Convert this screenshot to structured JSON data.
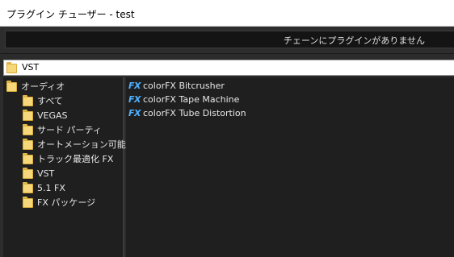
{
  "window": {
    "title": "プラグイン チューザー - test"
  },
  "chain": {
    "empty_text": "チェーンにプラグインがありません"
  },
  "path": {
    "text": "VST",
    "icon": "folder-icon"
  },
  "tree": {
    "root": {
      "label": "オーディオ",
      "icon": "folder-icon"
    },
    "items": [
      {
        "label": "すべて",
        "icon": "folder-icon"
      },
      {
        "label": "VEGAS",
        "icon": "folder-icon"
      },
      {
        "label": "サード パーティ",
        "icon": "folder-icon"
      },
      {
        "label": "オートメーション可能",
        "icon": "folder-icon"
      },
      {
        "label": "トラック最適化 FX",
        "icon": "folder-icon"
      },
      {
        "label": "VST",
        "icon": "folder-icon"
      },
      {
        "label": "5.1 FX",
        "icon": "folder-icon"
      },
      {
        "label": "FX パッケージ",
        "icon": "folder-icon"
      }
    ]
  },
  "plugins": [
    {
      "label": "colorFX Bitcrusher",
      "icon": "fx-icon"
    },
    {
      "label": "colorFX Tape Machine",
      "icon": "fx-icon"
    },
    {
      "label": "colorFX Tube Distortion",
      "icon": "fx-icon"
    }
  ],
  "colors": {
    "fx_icon": "#4fb0ff",
    "folder": "#f6d77a",
    "pane_background": "#1f1f1f"
  }
}
